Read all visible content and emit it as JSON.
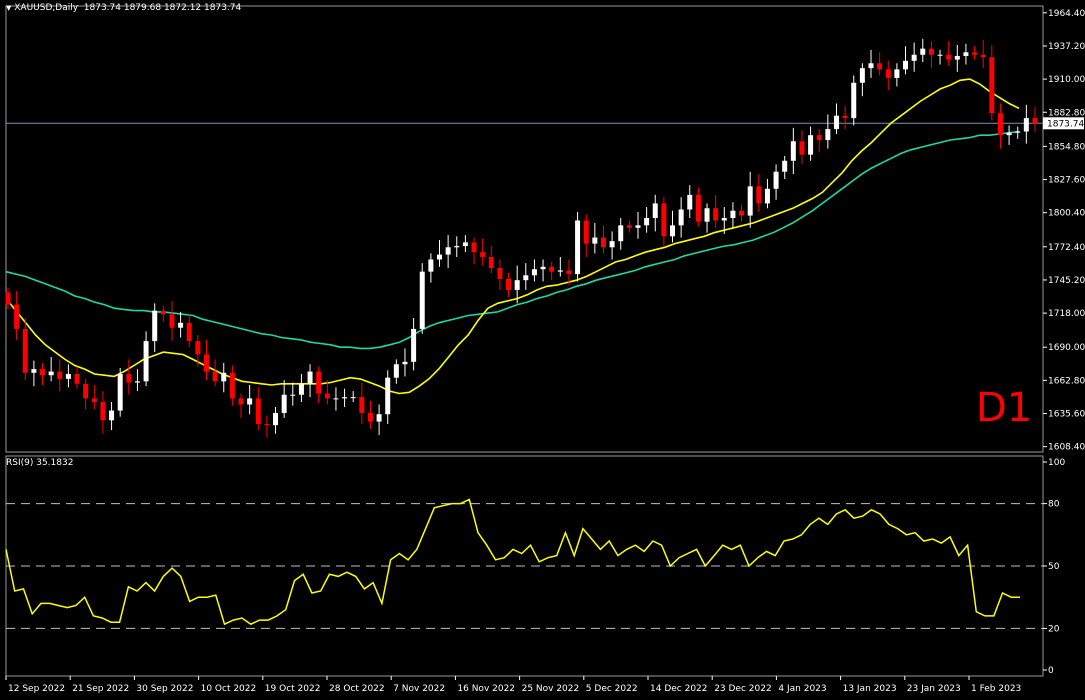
{
  "main_header": {
    "symbol": "XAUUSD,Daily",
    "ohlc": "1873.74 1879.68 1872.12 1873.74"
  },
  "rsi_header": "RSI(9) 35.1832",
  "timeframe_label": "D1",
  "current_price_label": "1873.74",
  "colors": {
    "background": "#000000",
    "bull": "#ffffff",
    "bear": "#ff0000",
    "ma_fast": "#ffff00",
    "ma_slow": "#20d8a0",
    "rsi": "#ffff00",
    "grid_dash": "#c0c0c0",
    "price_line": "#8090b0"
  },
  "chart_data": [
    {
      "type": "candlestick",
      "symbol": "XAUUSD",
      "timeframe": "Daily",
      "y_ticks": [
        "1964.40",
        "1937.20",
        "1910.00",
        "1882.80",
        "1854.80",
        "1827.60",
        "1800.40",
        "1772.40",
        "1745.20",
        "1718.00",
        "1690.00",
        "1662.80",
        "1635.60",
        "1608.40"
      ],
      "ylim": [
        1604,
        1970
      ],
      "x_ticks": [
        "12 Sep 2022",
        "21 Sep 2022",
        "30 Sep 2022",
        "10 Oct 2022",
        "19 Oct 2022",
        "28 Oct 2022",
        "7 Nov 2022",
        "16 Nov 2022",
        "25 Nov 2022",
        "5 Dec 2022",
        "14 Dec 2022",
        "23 Dec 2022",
        "4 Jan 2023",
        "13 Jan 2023",
        "23 Jan 2023",
        "1 Feb 2023"
      ],
      "current_price": 1873.74,
      "closes": [
        1725,
        1705,
        1669,
        1672,
        1667,
        1670,
        1664,
        1668,
        1660,
        1648,
        1645,
        1630,
        1638,
        1668,
        1661,
        1662,
        1695,
        1720,
        1717,
        1706,
        1710,
        1695,
        1684,
        1670,
        1662,
        1669,
        1648,
        1643,
        1648,
        1627,
        1626,
        1636,
        1651,
        1651,
        1660,
        1670,
        1652,
        1648,
        1648,
        1649,
        1649,
        1636,
        1629,
        1635,
        1665,
        1676,
        1678,
        1705,
        1752,
        1762,
        1766,
        1772,
        1773,
        1776,
        1768,
        1764,
        1755,
        1746,
        1737,
        1745,
        1749,
        1754,
        1756,
        1752,
        1753,
        1750,
        1794,
        1775,
        1780,
        1772,
        1777,
        1790,
        1788,
        1790,
        1796,
        1808,
        1781,
        1790,
        1803,
        1815,
        1793,
        1804,
        1794,
        1796,
        1802,
        1798,
        1822,
        1808,
        1820,
        1834,
        1843,
        1859,
        1848,
        1864,
        1860,
        1869,
        1880,
        1878,
        1907,
        1919,
        1923,
        1918,
        1911,
        1918,
        1925,
        1930,
        1935,
        1930,
        1930,
        1926,
        1929,
        1932,
        1930,
        1928,
        1882,
        1864,
        1866,
        1867,
        1878,
        1873.74
      ],
      "ma_fast": [
        1730,
        1720,
        1710,
        1700,
        1692,
        1686,
        1680,
        1675,
        1672,
        1668,
        1667,
        1666,
        1670,
        1675,
        1680,
        1683,
        1686,
        1685,
        1684,
        1680,
        1676,
        1672,
        1668,
        1665,
        1662,
        1661,
        1660,
        1659,
        1660,
        1660,
        1660,
        1660,
        1660,
        1661,
        1663,
        1665,
        1664,
        1661,
        1658,
        1654,
        1652,
        1653,
        1658,
        1664,
        1672,
        1682,
        1692,
        1700,
        1712,
        1722,
        1726,
        1728,
        1730,
        1733,
        1737,
        1740,
        1741,
        1743,
        1745,
        1748,
        1752,
        1756,
        1760,
        1762,
        1765,
        1768,
        1770,
        1772,
        1775,
        1777,
        1779,
        1781,
        1784,
        1786,
        1788,
        1790,
        1792,
        1795,
        1798,
        1801,
        1804,
        1808,
        1812,
        1817,
        1825,
        1833,
        1843,
        1851,
        1858,
        1866,
        1874,
        1880,
        1886,
        1892,
        1897,
        1902,
        1905,
        1909,
        1910,
        1906,
        1900,
        1895,
        1890,
        1886
      ],
      "ma_slow": [
        1752,
        1750,
        1748,
        1745,
        1742,
        1739,
        1736,
        1732,
        1730,
        1727,
        1725,
        1722,
        1721,
        1720,
        1720,
        1719,
        1719,
        1718,
        1717,
        1716,
        1713,
        1711,
        1709,
        1707,
        1705,
        1703,
        1701,
        1700,
        1698,
        1697,
        1696,
        1694,
        1693,
        1692,
        1690,
        1690,
        1689,
        1689,
        1690,
        1692,
        1694,
        1698,
        1703,
        1707,
        1710,
        1712,
        1714,
        1716,
        1717,
        1718,
        1719,
        1722,
        1725,
        1727,
        1730,
        1732,
        1735,
        1737,
        1740,
        1742,
        1745,
        1747,
        1749,
        1751,
        1753,
        1756,
        1758,
        1760,
        1762,
        1765,
        1767,
        1769,
        1771,
        1773,
        1774,
        1776,
        1778,
        1781,
        1784,
        1788,
        1792,
        1797,
        1802,
        1808,
        1814,
        1820,
        1826,
        1832,
        1837,
        1841,
        1845,
        1849,
        1852,
        1854,
        1856,
        1858,
        1860,
        1861,
        1862,
        1864,
        1864,
        1865,
        1866,
        1867
      ]
    },
    {
      "type": "line",
      "name": "RSI(9)",
      "last_value": 35.1832,
      "ylim": [
        0,
        100
      ],
      "y_ticks": [
        "100",
        "80",
        "50",
        "20",
        "0"
      ],
      "levels": [
        80,
        50,
        20
      ],
      "values": [
        58,
        38,
        39,
        27,
        32,
        32,
        31,
        30,
        31,
        35,
        26,
        25,
        23,
        23,
        40,
        38,
        42,
        38,
        45,
        49,
        45,
        33,
        35,
        35,
        36,
        22,
        24,
        25,
        22,
        24,
        24,
        26,
        29,
        43,
        46,
        37,
        38,
        46,
        45,
        47,
        45,
        39,
        42,
        32,
        53,
        56,
        53,
        58,
        68,
        78,
        79,
        80,
        80,
        82,
        66,
        60,
        53,
        54,
        58,
        56,
        60,
        52,
        54,
        55,
        66,
        55,
        68,
        63,
        58,
        62,
        55,
        58,
        60,
        57,
        62,
        60,
        50,
        54,
        56,
        58,
        50,
        55,
        60,
        58,
        60,
        50,
        54,
        57,
        55,
        62,
        63,
        65,
        70,
        73,
        70,
        75,
        77,
        73,
        74,
        77,
        75,
        70,
        68,
        65,
        66,
        62,
        63,
        61,
        64,
        55,
        60,
        28,
        26,
        26,
        37,
        35,
        35
      ]
    }
  ]
}
